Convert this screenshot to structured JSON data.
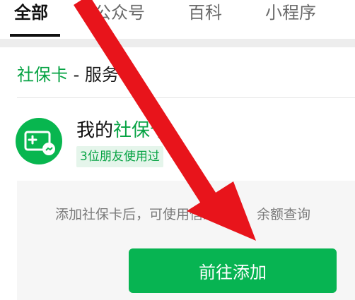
{
  "tabs": [
    {
      "label": "全部",
      "active": true
    },
    {
      "label": "公众号",
      "active": false
    },
    {
      "label": "百科",
      "active": false
    },
    {
      "label": "小程序",
      "active": false
    }
  ],
  "section": {
    "title_highlight": "社保卡",
    "title_rest": " - 服务"
  },
  "card": {
    "icon": "social-security-card-icon",
    "title_prefix": "我的",
    "title_highlight": "社保卡",
    "friends_tag": "3位朋友使用过"
  },
  "panel": {
    "description": "添加社保卡后，可使用信息查询、余额查询",
    "cta_label": "前往添加"
  },
  "colors": {
    "accent_green": "#07b452",
    "highlight_text": "#07a344",
    "annotation_arrow": "#e8141b"
  },
  "annotation": {
    "icon": "red-arrow-pointer"
  }
}
